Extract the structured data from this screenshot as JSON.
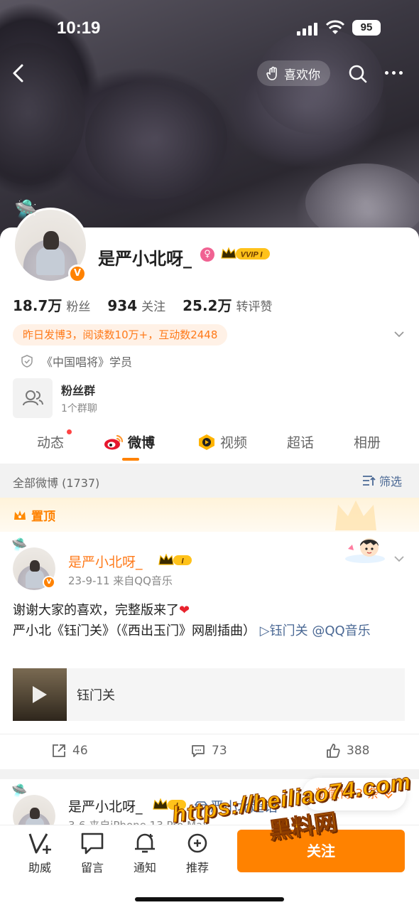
{
  "status_bar": {
    "time": "10:19",
    "battery": "95"
  },
  "nav": {
    "like_label": "喜欢你"
  },
  "profile": {
    "name": "是严小北呀_",
    "vip_label": "VVIP I",
    "stats": [
      {
        "num": "18.7万",
        "label": "粉丝"
      },
      {
        "num": "934",
        "label": "关注"
      },
      {
        "num": "25.2万",
        "label": "转评赞"
      }
    ],
    "activity": "昨日发博3，阅读数10万+，互动数2448",
    "badge": "《中国唱将》学员",
    "fan_group": {
      "title": "粉丝群",
      "subtitle": "1个群聊"
    }
  },
  "tabs": [
    {
      "label": "动态"
    },
    {
      "label": "微博"
    },
    {
      "label": "视频"
    },
    {
      "label": "超话"
    },
    {
      "label": "相册"
    }
  ],
  "filter": {
    "summary": "全部微博 (1737)",
    "button": "筛选"
  },
  "pinned": {
    "label": "置顶",
    "author": "是严小北呀_",
    "vip": "I",
    "meta": "23-9-11  来自QQ音乐",
    "line1": "谢谢大家的喜欢，完整版来了",
    "line2_prefix": "严小北《钰门关》（《西出玉门》网剧插曲）",
    "link_song": "▷钰门关",
    "link_at": "@QQ音乐",
    "music_title": "钰门关",
    "reposts": "46",
    "comments": "73",
    "likes": "388"
  },
  "post2": {
    "author": "是严小北呀_",
    "vip": "I",
    "topic": "严小北超话",
    "meta": "3-6  来自iPhone 13 Pro Max"
  },
  "new_posts": "新微博 3 条",
  "bottom_bar": {
    "items": [
      {
        "label": "助威"
      },
      {
        "label": "留言"
      },
      {
        "label": "通知"
      },
      {
        "label": "推荐"
      }
    ],
    "follow": "关注"
  },
  "watermark": {
    "url": "https://heiliao74.com",
    "cn": "黑料网"
  },
  "colors": {
    "accent": "#ff8200",
    "link": "#4a6894",
    "pill_bg": "#fff1e6"
  }
}
